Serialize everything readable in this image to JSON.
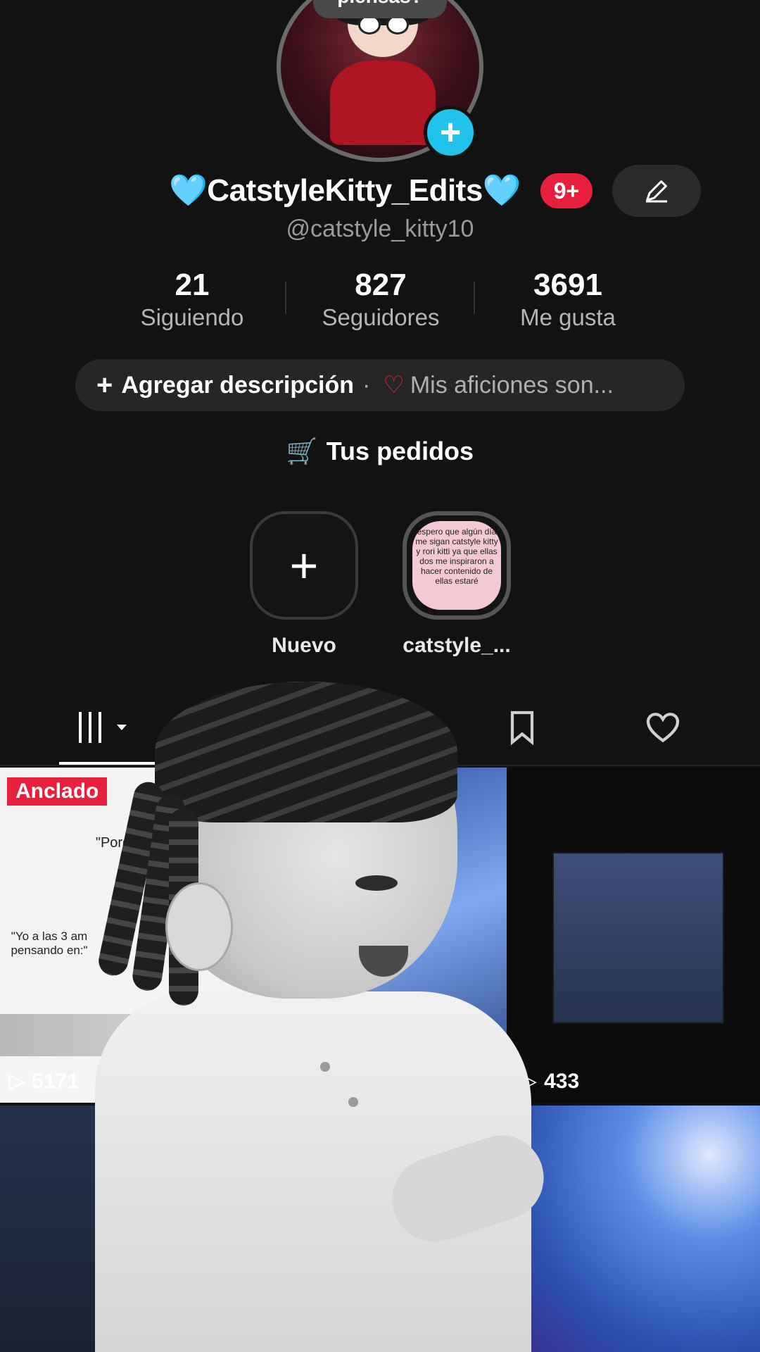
{
  "profile": {
    "avatar_tag": "piensas?",
    "display_name": "CatstyleKitty_Edits",
    "name_prefix_emoji": "🩵",
    "name_suffix_emoji": "🩵",
    "notification_badge": "9+",
    "username": "@catstyle_kitty10"
  },
  "stats": [
    {
      "value": "21",
      "label": "Siguiendo"
    },
    {
      "value": "827",
      "label": "Seguidores"
    },
    {
      "value": "3691",
      "label": "Me gusta"
    }
  ],
  "description": {
    "add_label": "Agregar descripción",
    "separator": "·",
    "hobbies_label": "Mis aficiones son..."
  },
  "orders_label": "Tus pedidos",
  "highlights": [
    {
      "label": "Nuevo"
    },
    {
      "label": "catstyle_...",
      "story_text": "espero que algún día me sigan catstyle kitty y rori kitti ya que ellas dos me inspiraron a hacer contenido de ellas estaré"
    }
  ],
  "grid": {
    "pinned_label": "Anclado",
    "meme_text_top": "\"Porque n",
    "meme_text_bottom": "\"Yo a las 3 am pensando en:\"",
    "items": [
      {
        "views": "5171"
      },
      {
        "views": "433"
      }
    ]
  },
  "colors": {
    "background": "#121212",
    "accent_red": "#e9203d",
    "accent_cyan": "#20c4ea"
  }
}
